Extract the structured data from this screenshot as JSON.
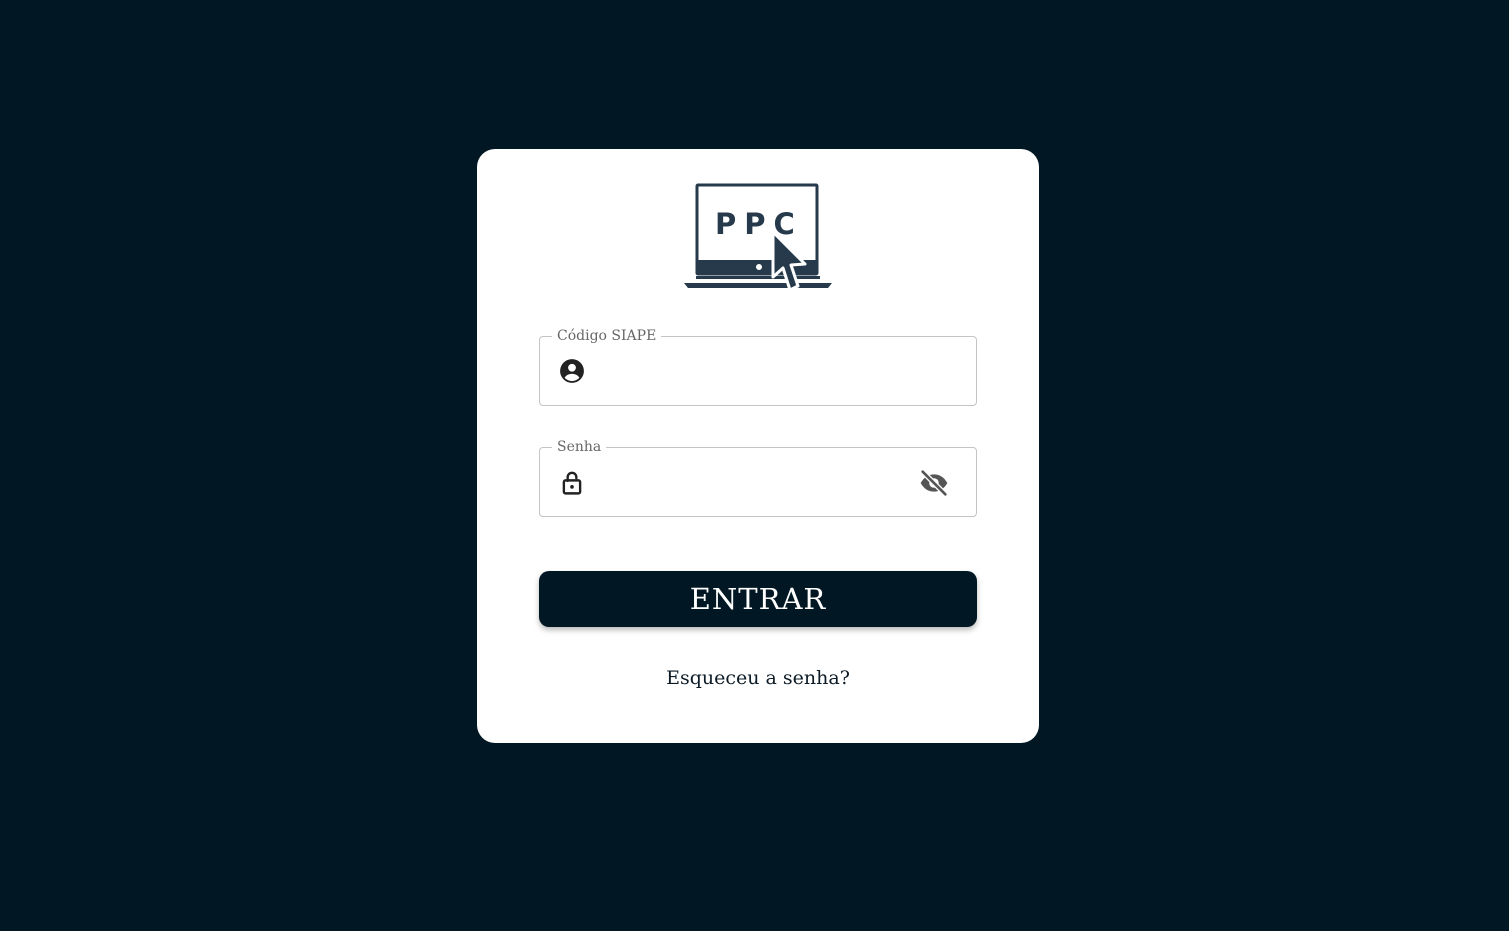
{
  "logo": {
    "text": "PPC",
    "icon": "laptop-cursor-logo"
  },
  "login": {
    "user_field": {
      "label": "Código SIAPE",
      "value": "",
      "placeholder": "",
      "icon": "account-circle-icon"
    },
    "password_field": {
      "label": "Senha",
      "value": "",
      "placeholder": "",
      "icon": "lock-open-icon",
      "toggle_icon": "eye-off-icon"
    },
    "submit_label": "ENTRAR",
    "forgot_link": "Esqueceu a senha?"
  },
  "colors": {
    "background": "#011824",
    "card": "#ffffff",
    "logo": "#273a4b",
    "button": "#011824",
    "button_text": "#ffffff"
  }
}
